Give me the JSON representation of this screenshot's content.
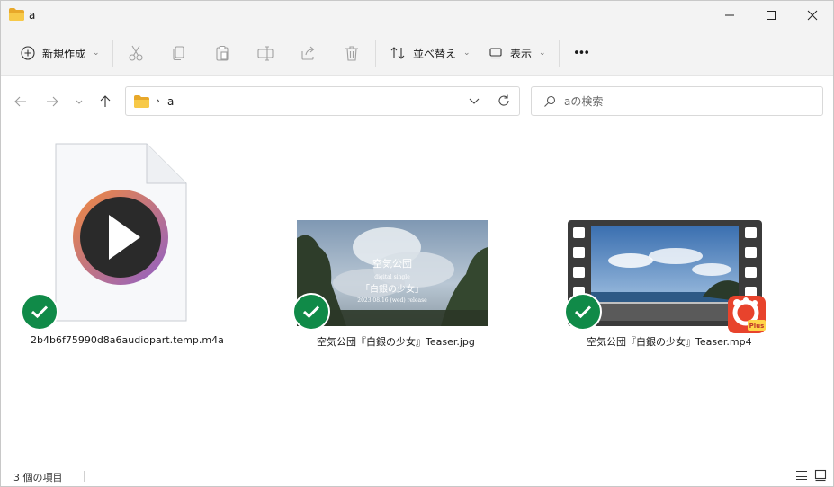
{
  "window": {
    "title": "a"
  },
  "commands": {
    "new_label": "新規作成",
    "sort_label": "並べ替え",
    "view_label": "表示",
    "more_label": "•••"
  },
  "navigation": {
    "path_separator": "›",
    "current_folder": "a"
  },
  "search": {
    "placeholder": "aの検索"
  },
  "files": [
    {
      "name": "2b4b6f75990d8a6audiopart.temp.m4a",
      "sync": "synced-check"
    },
    {
      "name": "空気公団『白銀の少女』Teaser.jpg",
      "sync": "synced-check",
      "thumbnail_text": [
        "空気公団",
        "digital single",
        "「白銀の少女」",
        "2023.08.16 (wed) release"
      ]
    },
    {
      "name": "空気公団『白銀の少女』Teaser.mp4",
      "sync": "synced-check",
      "badge": "Plus"
    }
  ],
  "status": {
    "item_count": "3 個の項目"
  },
  "colors": {
    "accent": "#108a48",
    "folder": "#f4c146",
    "player_gradient_start": "#f28a3c",
    "player_gradient_end": "#8f5fc9",
    "badge_red": "#e8432c"
  }
}
